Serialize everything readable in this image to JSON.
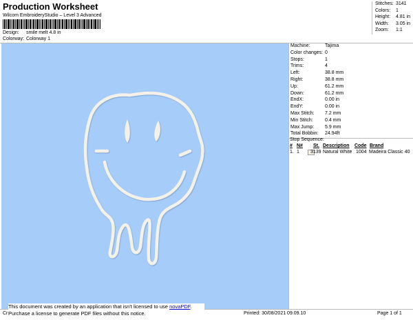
{
  "header": {
    "title": "Production Worksheet",
    "subtitle": "Wilcom EmbroideryStudio – Level 3 Advanced",
    "design_label": "Design:",
    "design_value": "smile melt 4.8 in",
    "colorway_label": "Colorway:",
    "colorway_value": "Colorway 1"
  },
  "top_stats": [
    {
      "label": "Stitches:",
      "value": "3141"
    },
    {
      "label": "Colors:",
      "value": "1"
    },
    {
      "label": "Height:",
      "value": "4.81 in"
    },
    {
      "label": "Width:",
      "value": "3.05 in"
    },
    {
      "label": "Zoom:",
      "value": "1:1"
    }
  ],
  "machine_info": [
    {
      "label": "Machine:",
      "value": "Tajima"
    },
    {
      "label": "Color changes:",
      "value": "0"
    },
    {
      "label": "Stops:",
      "value": "1"
    },
    {
      "label": "Trims:",
      "value": "4"
    },
    {
      "label": "Left:",
      "value": "38.8 mm"
    },
    {
      "label": "Right:",
      "value": "38.8 mm"
    },
    {
      "label": "Up:",
      "value": "61.2 mm"
    },
    {
      "label": "Down:",
      "value": "61.2 mm"
    },
    {
      "label": "EndX:",
      "value": "0.00 in"
    },
    {
      "label": "EndY:",
      "value": "0.00 in"
    },
    {
      "label": "Max Stitch:",
      "value": "7.2 mm"
    },
    {
      "label": "Min Stitch:",
      "value": "0.4 mm"
    },
    {
      "label": "Max Jump:",
      "value": "5.9 mm"
    },
    {
      "label": "Total Bobbin:",
      "value": "24.94ft"
    }
  ],
  "stop_sequence": {
    "title": "Stop Sequence:",
    "headers": [
      "#",
      "N#",
      "St.",
      "Description",
      "Code",
      "Brand"
    ],
    "rows": [
      {
        "num": "1.",
        "n": "1",
        "st": "3139",
        "description": "Natural White",
        "code": "1004",
        "brand": "Madeira Classic 40"
      }
    ]
  },
  "footer": {
    "notice_line1_prefix": "This document was created by an application that isn't licensed to use ",
    "notice_link": "novaPDF",
    "notice_line1_suffix": ".",
    "notice_line2": "Purchase a license to generate PDF files without this notice.",
    "left_text": "Cr",
    "printed": "Printed: 30/08/2021 09.09.10",
    "page": "Page 1 of 1"
  },
  "colors": {
    "design_background": "#a6cdfa",
    "thread": "#f4f1e8"
  }
}
